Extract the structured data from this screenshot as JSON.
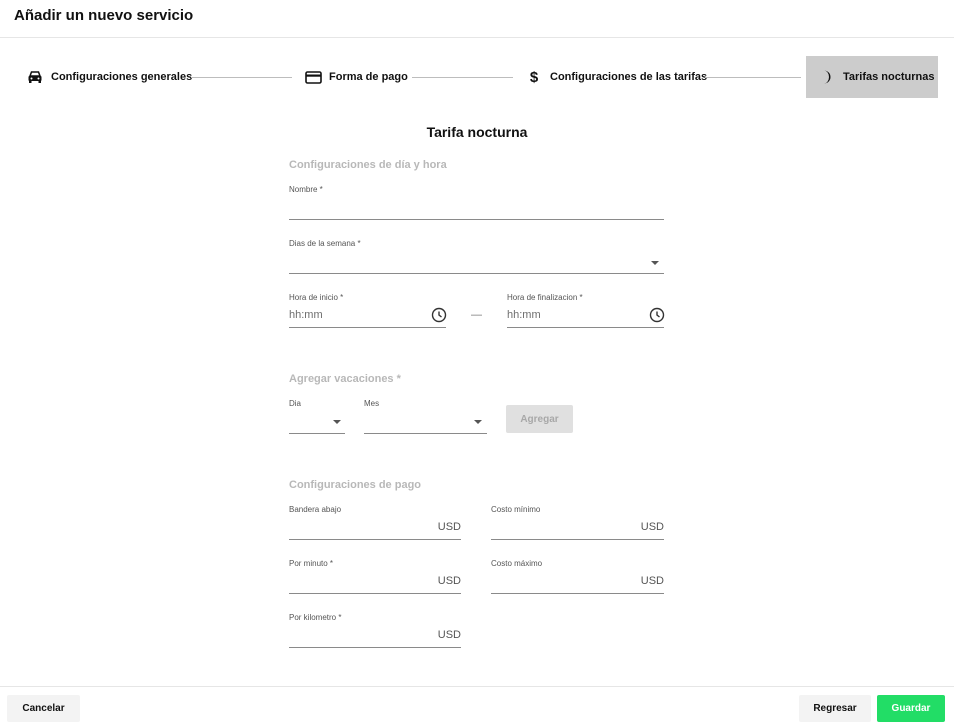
{
  "dialog": {
    "title": "Añadir un nuevo servicio"
  },
  "stepper": {
    "steps": [
      {
        "label": "Configuraciones generales",
        "icon": "car-icon",
        "active": false
      },
      {
        "label": "Forma de pago",
        "icon": "credit-card-icon",
        "active": false
      },
      {
        "label": "Configuraciones de las tarifas",
        "icon": "dollar-icon",
        "active": false
      },
      {
        "label": "Tarifas nocturnas",
        "icon": "moon-icon",
        "active": true
      }
    ]
  },
  "form": {
    "title": "Tarifa nocturna",
    "day_time": {
      "heading": "Configuraciones de día y hora",
      "name_label": "Nombre *",
      "weekdays_label": "Dias de la semana *",
      "start_label": "Hora de inicio *",
      "start_placeholder": "hh:mm",
      "separator": "—",
      "end_label": "Hora de finalizacion *",
      "end_placeholder": "hh:mm"
    },
    "holidays": {
      "heading": "Agregar vacaciones *",
      "day_label": "Dia",
      "month_label": "Mes",
      "add_button": "Agregar"
    },
    "payment": {
      "heading": "Configuraciones de pago",
      "flag_down_label": "Bandera abajo",
      "min_cost_label": "Costo mínimo",
      "per_minute_label": "Por minuto *",
      "max_cost_label": "Costo máximo",
      "per_km_label": "Por kilometro *",
      "currency": "USD"
    }
  },
  "footer": {
    "cancel": "Cancelar",
    "back": "Regresar",
    "save": "Guardar"
  },
  "colors": {
    "active_step_bg": "#cccccc",
    "save_button": "#22dd66",
    "section_heading": "#b8b8b8"
  }
}
